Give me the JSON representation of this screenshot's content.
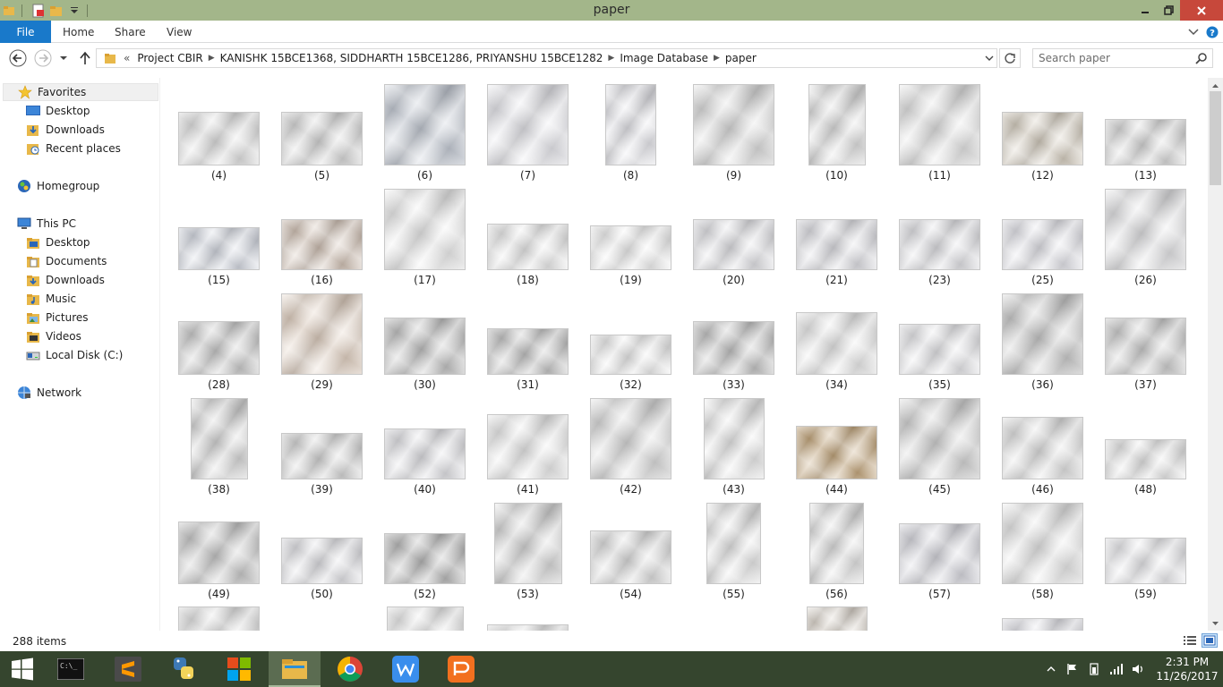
{
  "window": {
    "title": "paper"
  },
  "ribbon": {
    "tabs": [
      {
        "label": "File"
      },
      {
        "label": "Home"
      },
      {
        "label": "Share"
      },
      {
        "label": "View"
      }
    ]
  },
  "address": {
    "overflow": "«",
    "crumbs": [
      "Project CBIR",
      "KANISHK 15BCE1368, SIDDHARTH 15BCE1286, PRIYANSHU 15BCE1282",
      "Image Database",
      "paper"
    ]
  },
  "search": {
    "placeholder": "Search paper"
  },
  "navpane": {
    "favorites": {
      "label": "Favorites",
      "items": [
        "Desktop",
        "Downloads",
        "Recent places"
      ]
    },
    "homegroup": {
      "label": "Homegroup"
    },
    "thispc": {
      "label": "This PC",
      "items": [
        "Desktop",
        "Documents",
        "Downloads",
        "Music",
        "Pictures",
        "Videos",
        "Local Disk (C:)"
      ]
    },
    "network": {
      "label": "Network"
    }
  },
  "files": [
    "(4)",
    "(5)",
    "(6)",
    "(7)",
    "(8)",
    "(9)",
    "(10)",
    "(11)",
    "(12)",
    "(13)",
    "(15)",
    "(16)",
    "(17)",
    "(18)",
    "(19)",
    "(20)",
    "(21)",
    "(23)",
    "(25)",
    "(26)",
    "(28)",
    "(29)",
    "(30)",
    "(31)",
    "(32)",
    "(33)",
    "(34)",
    "(35)",
    "(36)",
    "(37)",
    "(38)",
    "(39)",
    "(40)",
    "(41)",
    "(42)",
    "(43)",
    "(44)",
    "(45)",
    "(46)",
    "(48)",
    "(49)",
    "(50)",
    "(52)",
    "(53)",
    "(54)",
    "(55)",
    "(56)",
    "(57)",
    "(58)",
    "(59)"
  ],
  "status": {
    "item_count": "288 items"
  },
  "taskbar": {
    "apps": [
      "start",
      "cmd",
      "sublime-text",
      "python",
      "office",
      "file-explorer",
      "chrome",
      "wps-writer",
      "wps-presentation"
    ],
    "clock": {
      "time": "2:31 PM",
      "date": "11/26/2017"
    }
  }
}
